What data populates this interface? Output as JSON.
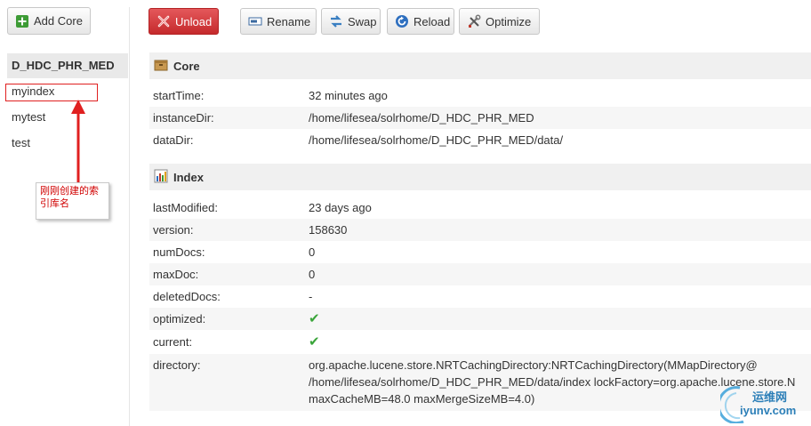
{
  "toolbar": {
    "add_core": "Add Core",
    "unload": "Unload",
    "rename": "Rename",
    "swap": "Swap",
    "reload": "Reload",
    "optimize": "Optimize"
  },
  "sidebar": {
    "cores": [
      "D_HDC_PHR_MED",
      "myindex",
      "mytest",
      "test"
    ],
    "selected": "D_HDC_PHR_MED"
  },
  "annotation": {
    "text": "刚刚创建的索引库名",
    "color": "#d00000"
  },
  "core_section": {
    "title": "Core",
    "rows": [
      {
        "key": "startTime:",
        "value": "32 minutes ago"
      },
      {
        "key": "instanceDir:",
        "value": "/home/lifesea/solrhome/D_HDC_PHR_MED"
      },
      {
        "key": "dataDir:",
        "value": "/home/lifesea/solrhome/D_HDC_PHR_MED/data/"
      }
    ]
  },
  "index_section": {
    "title": "Index",
    "rows": [
      {
        "key": "lastModified:",
        "value": "23 days ago"
      },
      {
        "key": "version:",
        "value": "158630"
      },
      {
        "key": "numDocs:",
        "value": "0"
      },
      {
        "key": "maxDoc:",
        "value": "0"
      },
      {
        "key": "deletedDocs:",
        "value": "-"
      },
      {
        "key": "optimized:",
        "value": "✔"
      },
      {
        "key": "current:",
        "value": "✔"
      }
    ],
    "directory": {
      "key": "directory:",
      "lines": [
        "org.apache.lucene.store.NRTCachingDirectory:NRTCachingDirectory(MMapDirectory@",
        "/home/lifesea/solrhome/D_HDC_PHR_MED/data/index lockFactory=org.apache.lucene.store.N",
        "maxCacheMB=48.0 maxMergeSizeMB=4.0)"
      ]
    }
  },
  "watermark": {
    "line1": "运维网",
    "line2": "iyunv.com"
  },
  "colors": {
    "unload_button": "#d0393b",
    "check": "#3aa53a",
    "section_header": "#f0f0f0"
  }
}
